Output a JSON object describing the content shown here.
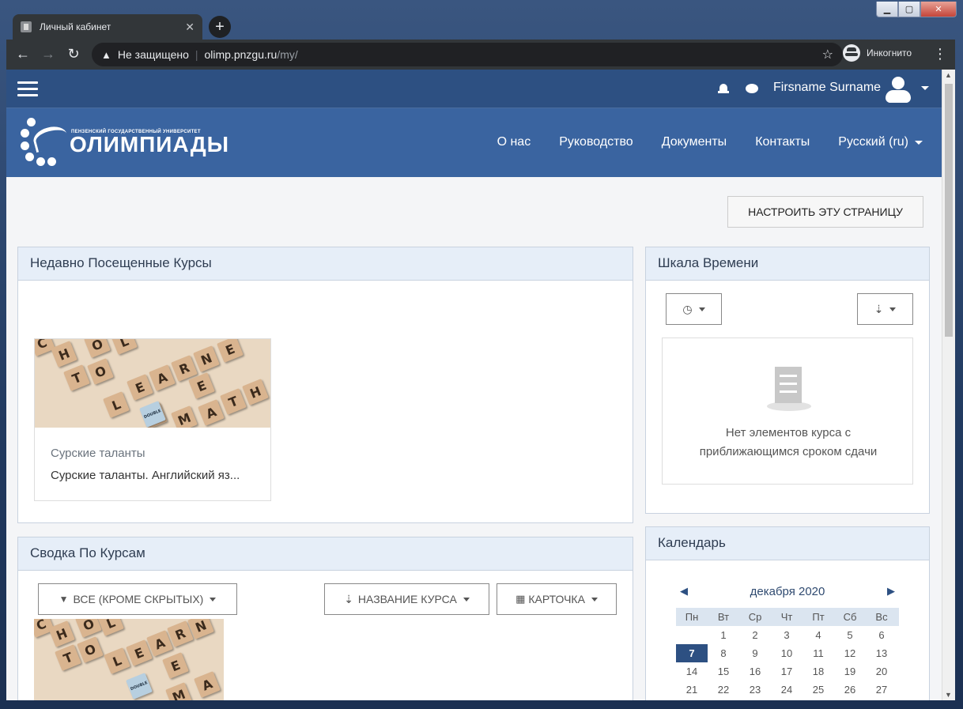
{
  "browser": {
    "tab_title": "Личный кабинет",
    "tab_close": "✕",
    "new_tab": "+",
    "insecure_label": "Не защищено",
    "url_host": "olimp.pnzgu.ru",
    "url_path": "/my/",
    "incognito_label": "Инкогнито"
  },
  "topnav": {
    "user_name": "Firsname Surname"
  },
  "brand": {
    "logo_small": "ПЕНЗЕНСКИЙ ГОСУДАРСТВЕННЫЙ УНИВЕРСИТЕТ",
    "logo_big": "ОЛИМПИАДЫ",
    "links": [
      "О нас",
      "Руководство",
      "Документы",
      "Контакты"
    ],
    "language": "Русский (ru)"
  },
  "page": {
    "customize_button": "НАСТРОИТЬ ЭТУ СТРАНИЦУ"
  },
  "recent_courses": {
    "title": "Недавно Посещенные Курсы",
    "course_category": "Сурские таланты",
    "course_name": "Сурские таланты. Английский яз..."
  },
  "course_overview": {
    "title": "Сводка По Курсам",
    "filter_label": "ВСЕ (КРОМЕ СКРЫТЫХ)",
    "sort_label": "НАЗВАНИЕ КУРСА",
    "view_label": "КАРТОЧКА"
  },
  "timeline": {
    "title": "Шкала Времени",
    "empty_line1": "Нет элементов курса с",
    "empty_line2": "приближающимся сроком сдачи"
  },
  "calendar": {
    "title": "Календарь",
    "month": "декабря 2020",
    "prev": "◀",
    "next": "▶",
    "weekdays": [
      "Пн",
      "Вт",
      "Ср",
      "Чт",
      "Пт",
      "Сб",
      "Вс"
    ],
    "weeks": [
      [
        "",
        "1",
        "2",
        "3",
        "4",
        "5",
        "6"
      ],
      [
        "7",
        "8",
        "9",
        "10",
        "11",
        "12",
        "13"
      ],
      [
        "14",
        "15",
        "16",
        "17",
        "18",
        "19",
        "20"
      ],
      [
        "21",
        "22",
        "23",
        "24",
        "25",
        "26",
        "27"
      ]
    ],
    "today": "7"
  },
  "colors": {
    "topnav": "#2d5082",
    "brandbar": "#3a64a0",
    "block_header": "#e6eef8"
  }
}
